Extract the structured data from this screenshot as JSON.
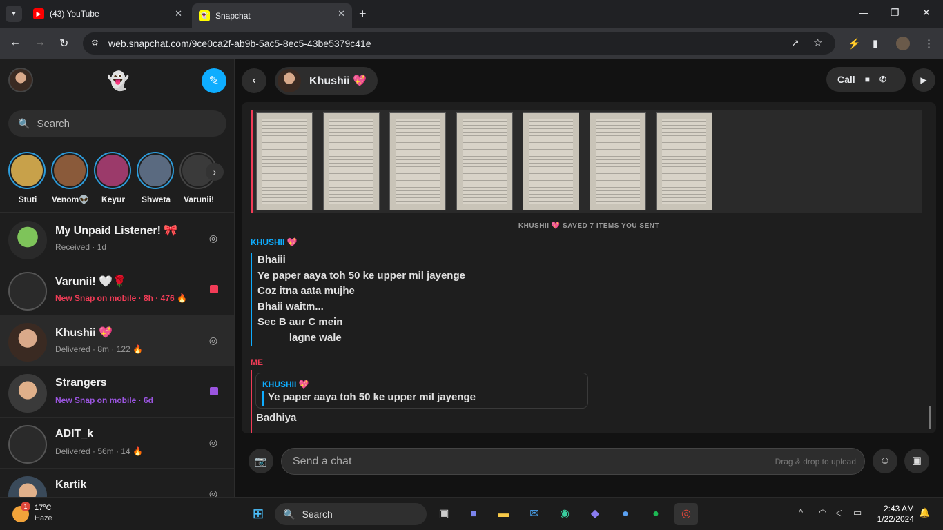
{
  "browser": {
    "tabs": [
      {
        "title": "(43) YouTube"
      },
      {
        "title": "Snapchat"
      }
    ],
    "url": "web.snapchat.com/9ce0ca2f-ab9b-5ac5-8ec5-43be5379c41e"
  },
  "sidebar": {
    "search_placeholder": "Search",
    "stories": [
      {
        "name": "Stuti",
        "color": "#c8a14a"
      },
      {
        "name": "Venom👽",
        "color": "#8a5a3a"
      },
      {
        "name": "Keyur",
        "color": "#9b3a6a"
      },
      {
        "name": "Shweta",
        "color": "#5a6a80"
      },
      {
        "name": "Varunii!",
        "color": "#3a3a3a"
      }
    ],
    "chats": [
      {
        "name": "My Unpaid Listener! 🎀",
        "status": "Received · 1d",
        "status_color": "#9a9a9a",
        "icon": "camera-icon"
      },
      {
        "name": "Varunii! 🤍🌹",
        "status": "New Snap on mobile · 8h · 476 🔥",
        "status_color": "#f23c57",
        "icon": "red-square"
      },
      {
        "name": "Khushii 💖",
        "status": "Delivered · 8m · 122 🔥",
        "status_color": "#9a9a9a",
        "icon": "camera-icon"
      },
      {
        "name": "Strangers",
        "status": "New Snap on mobile · 6d",
        "status_color": "#9b55e0",
        "icon": "purple-square"
      },
      {
        "name": "ADIT_k",
        "status": "Delivered · 56m · 14 🔥",
        "status_color": "#9a9a9a",
        "icon": "camera-icon"
      },
      {
        "name": "Kartik",
        "status": "",
        "status_color": "#9a9a9a",
        "icon": "camera-icon"
      }
    ]
  },
  "chat": {
    "contact_name": "Khushii 💖",
    "call_label": "Call",
    "saved_notice": "KHUSHII 💖 SAVED 7 ITEMS YOU SENT",
    "messages": [
      {
        "sender": "KHUSHII 💖",
        "color": "#0eadff",
        "lines": [
          "Bhaiii",
          "Ye paper aaya toh 50 ke upper mil jayenge",
          "Coz itna aata mujhe",
          "Bhaii waitm...",
          "Sec B aur C mein",
          "_____ lagne wale"
        ]
      },
      {
        "sender": "ME",
        "color": "#f23c57",
        "quote_sender": "KHUSHII 💖",
        "quote_text": "Ye paper aaya toh 50 ke upper mil jayenge",
        "lines": [
          "Badhiya"
        ]
      }
    ],
    "input_placeholder": "Send a chat",
    "drag_hint": "Drag & drop to upload"
  },
  "taskbar": {
    "temperature": "17°C",
    "weather": "Haze",
    "search_label": "Search",
    "time": "2:43 AM",
    "date": "1/22/2024",
    "notification_badge": "1"
  }
}
